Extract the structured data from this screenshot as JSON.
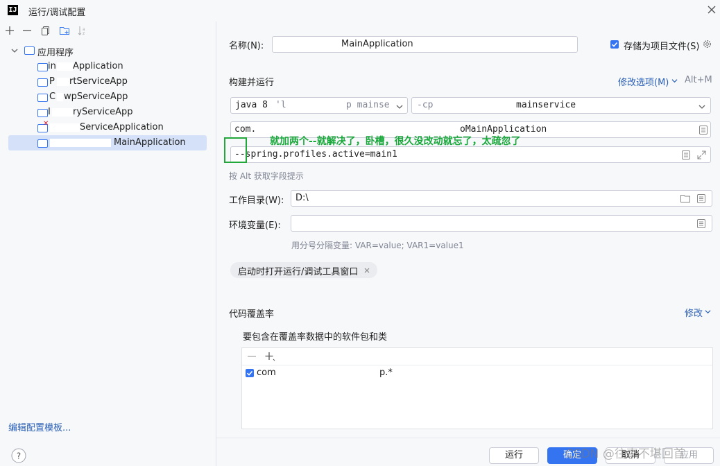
{
  "window": {
    "title": "运行/调试配置",
    "logo_text": "IJ"
  },
  "left_toolbar": [
    "add-icon",
    "remove-icon",
    "copy-icon",
    "new-folder-icon",
    "sort-icon"
  ],
  "tree": {
    "root_label": "应用程序",
    "items": [
      {
        "label": "Application",
        "prefix": "in"
      },
      {
        "label": "rtServiceApp",
        "prefix": "P"
      },
      {
        "label": "wpServiceApp",
        "prefix": "C"
      },
      {
        "label": "ryServiceApp",
        "prefix": "I"
      },
      {
        "label": "ServiceApplication",
        "prefix": ""
      },
      {
        "label": "MainApplication",
        "prefix": ""
      }
    ],
    "selected_index": 5
  },
  "edit_templates_label": "编辑配置模板...",
  "name_label": "名称(N):",
  "name_value": "MainApplication",
  "store_as_project_file": {
    "label": "存储为项目文件(S)",
    "checked": true
  },
  "build_run": {
    "section_label": "构建并运行",
    "modify_options": "修改选项(M)",
    "shortcut": "Alt+M",
    "jdk": "java 8",
    "jdk_suffix": "'l",
    "jdk_blurred": "p mainse",
    "classpath_prefix": "-cp",
    "classpath_value": "mainservice",
    "main_class_prefix": "com.",
    "main_class_value": "oMainApplication",
    "program_args": "--spring.profiles.active=main1",
    "hint": "按 Alt 获取字段提示"
  },
  "working_dir": {
    "label": "工作目录(W):",
    "value": "D:\\"
  },
  "env_vars": {
    "label": "环境变量(E):",
    "value": "",
    "hint": "用分号分隔变量: VAR=value; VAR1=value1"
  },
  "tool_window_chip": "启动时打开运行/调试工具窗口",
  "coverage": {
    "section_label": "代码覆盖率",
    "modify": "修改",
    "include_label": "要包含在覆盖率数据中的软件包和类",
    "entry_prefix": "com",
    "entry_suffix": "p.*",
    "entry_checked": true
  },
  "buttons": {
    "run": "运行",
    "ok": "确定",
    "cancel": "取消",
    "apply": "应用"
  },
  "annotation": "就加两个--就解决了，卧槽，很久没改动就忘了，太疏忽了",
  "watermark": "CSDN @往事不堪回首",
  "colors": {
    "accent": "#3574f0",
    "annotation": "#18a83a",
    "selection": "#d5e1f8"
  }
}
